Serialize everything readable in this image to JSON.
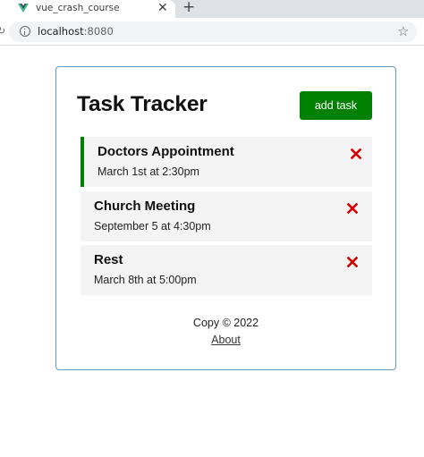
{
  "browser": {
    "tab_title": "vue_crash_course",
    "tab_close_glyph": "✕",
    "new_tab_glyph": "+",
    "url_host": "localhost",
    "url_port": ":8080",
    "icons": [
      "vue-favicon-icon",
      "info-icon",
      "star-icon"
    ]
  },
  "app": {
    "title": "Task Tracker",
    "add_button_label": "add task",
    "colors": {
      "accent": "#008000",
      "delete": "#d40000",
      "border": "#5f9ec0"
    }
  },
  "tasks": [
    {
      "text": "Doctors Appointment",
      "day": "March 1st at 2:30pm",
      "reminder": true
    },
    {
      "text": "Church Meeting",
      "day": "September 5 at 4:30pm",
      "reminder": false
    },
    {
      "text": "Rest",
      "day": "March 8th at 5:00pm",
      "reminder": false
    }
  ],
  "footer": {
    "copyright": "Copy © 2022",
    "about_link": "About"
  }
}
